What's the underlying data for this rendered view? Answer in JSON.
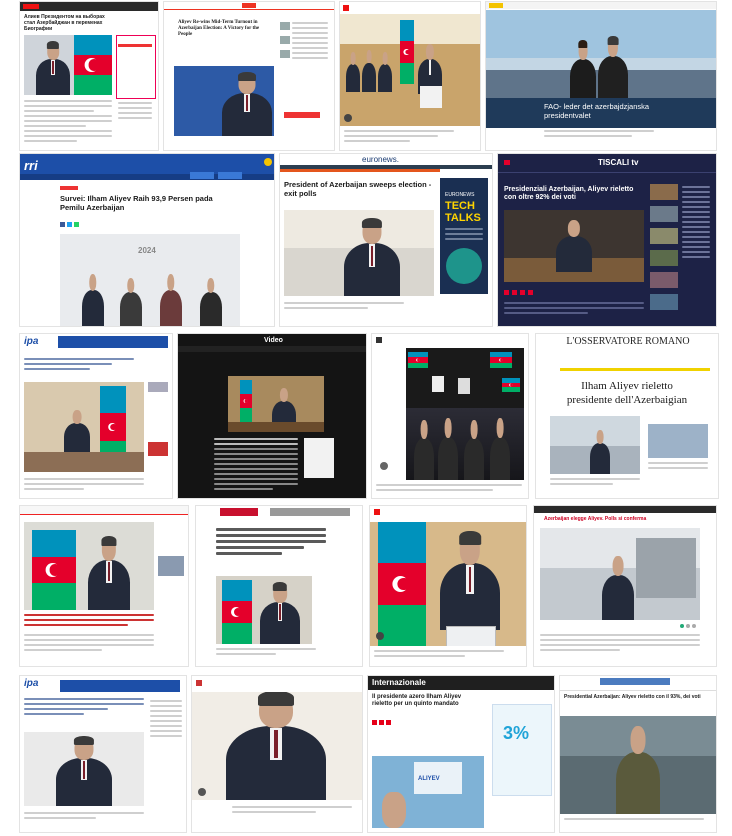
{
  "tiles": {
    "t1": {
      "headline": "Алиев Президентом на выборах стал Азербайджан в переменах Биографии"
    },
    "t2": {
      "headline": "Aliyev Re-wins Mid-Term Turnout in Azerbaijan Election: A Victory for the People"
    },
    "t4": {
      "headline": "FAO- leder det azerbajdzjanska presidentvalet"
    },
    "t5": {
      "logo": "rri"
    },
    "t6": {
      "brand": "euronews.",
      "headline": "President of Azerbaijan sweeps election - exit polls",
      "ad_line1": "EURONEWS",
      "ad_line2": "TECH",
      "ad_line3": "TALKS"
    },
    "t7": {
      "brand": "TISCALI tv",
      "headline": "Presidenziali Azerbaijan, Aliyev rieletto con oltre 92% dei voti"
    },
    "t8": {
      "headline": "Survei: Ilham Aliyev Raih 93,9 Persen pada Pemilu Azerbaijan",
      "year": "2024"
    },
    "t9": {
      "logo": "ipa"
    },
    "t10": {
      "tab": "Video"
    },
    "t12": {
      "masthead": "L'OSSERVATORE ROMANO",
      "headline_line1": "Ilham Aliyev rieletto",
      "headline_line2": "presidente dell'Azerbaigian"
    },
    "t16": {
      "kicker": "Azerbaijan elegge Aliyev. Polls si conferma"
    },
    "t17": {
      "logo": "ipa"
    },
    "t19": {
      "masthead": "Internazionale",
      "headline": "Il presidente azero Ilham Aliyev rieletto per un quinto mandato",
      "ad": "3%",
      "sign": "ALIYEV"
    },
    "t20": {
      "headline": "Presidential Azerbaijan: Aliyev rieletto con il 93%, dei voti"
    }
  },
  "colors": {
    "flag_blue": "#0092bc",
    "flag_red": "#e4002b",
    "flag_green": "#00af66",
    "euronews_orange": "#e4561d",
    "tiscali_navy": "#1d2246",
    "internazionale_red": "#e60019"
  }
}
